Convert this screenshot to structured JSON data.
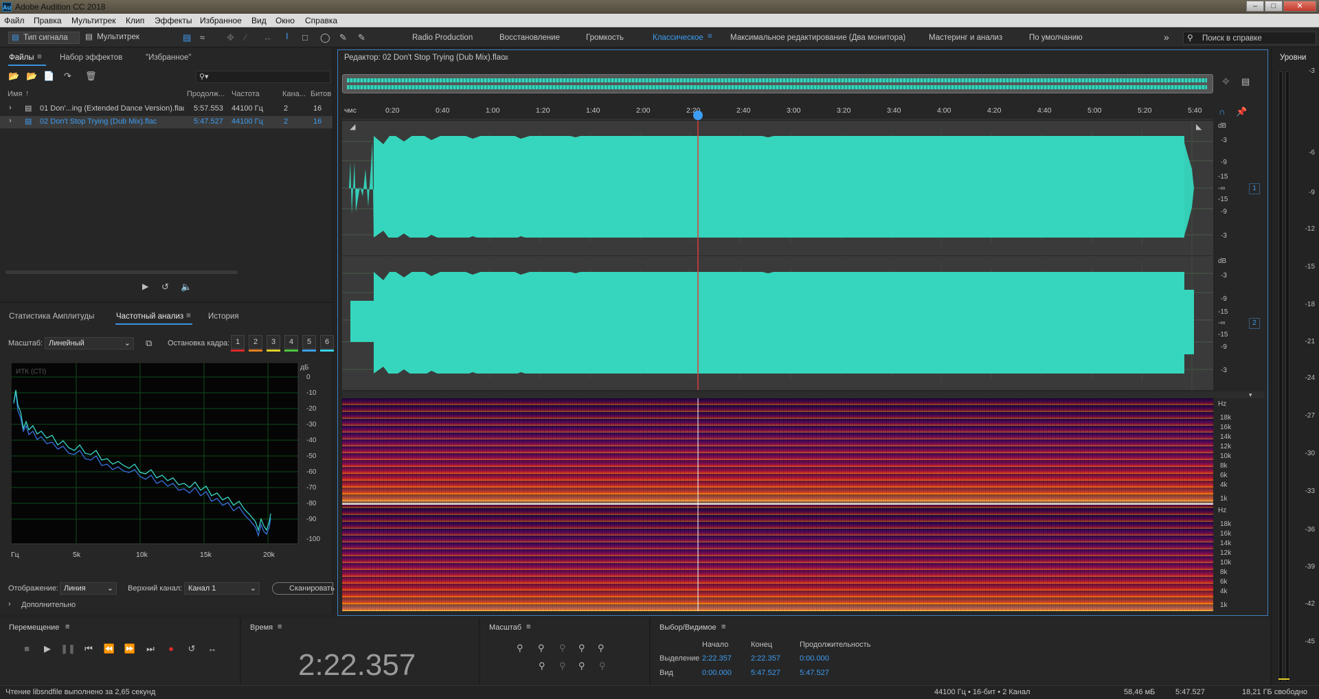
{
  "app": {
    "title": "Adobe Audition CC 2018",
    "logo": "Au"
  },
  "menu": [
    "Файл",
    "Правка",
    "Мультитрек",
    "Клип",
    "Эффекты",
    "Избранное",
    "Вид",
    "Окно",
    "Справка"
  ],
  "toolbar": {
    "waveform_label": "Тип сигнала",
    "multitrack_label": "Мультитрек",
    "workspaces": [
      "Radio Production",
      "Восстановление",
      "Громкость",
      "Классическое",
      "Максимальное редактирование (Два монитора)",
      "Мастеринг и анализ",
      "По умолчанию"
    ],
    "active_workspace": "Классическое",
    "search_placeholder": "Поиск в справке"
  },
  "files_panel": {
    "tabs": [
      "Файлы",
      "Набор эффектов",
      "\"Избранное\""
    ],
    "columns": [
      "Имя",
      "Продолж...",
      "Частота",
      "Кана...",
      "Битов"
    ],
    "rows": [
      {
        "name": "01 Don'...ing (Extended Dance Version).flac",
        "duration": "5:57.553",
        "rate": "44100 Гц",
        "channels": "2",
        "bits": "16",
        "selected": false
      },
      {
        "name": "02 Don't Stop Trying (Dub Mix).flac",
        "duration": "5:47.527",
        "rate": "44100 Гц",
        "channels": "2",
        "bits": "16",
        "selected": true
      }
    ]
  },
  "analysis_panel": {
    "tabs": [
      "Статистика Амплитуды",
      "Частотный анализ",
      "История"
    ],
    "scale_label": "Масштаб:",
    "scale_value": "Линейный",
    "freeze_label": "Остановка кадра:",
    "freeze_slots": [
      "1",
      "2",
      "3",
      "4",
      "5",
      "6"
    ],
    "freeze_colors": [
      "#e02a2a",
      "#e6801e",
      "#e2d12a",
      "#4ec83e",
      "#3fa0e6",
      "#3ad3e6"
    ],
    "plot_title": "ИТК (СТI)",
    "db_unit": "дБ",
    "db_ticks": [
      "0",
      "-10",
      "-20",
      "-30",
      "-40",
      "-50",
      "-60",
      "-70",
      "-80",
      "-90",
      "-100"
    ],
    "freq_ticks": [
      "Гц",
      "5k",
      "10k",
      "15k",
      "20k"
    ],
    "display_label": "Отображение:",
    "display_value": "Линия",
    "channel_label": "Верхний канал:",
    "channel_value": "Канал 1",
    "scan_label": "Сканировать",
    "advanced_label": "Дополнительно"
  },
  "editor": {
    "title": "Редактор: 02 Don't Stop Trying (Dub Mix).flac",
    "time_unit": "чмс",
    "time_ticks": [
      "0:20",
      "0:40",
      "1:00",
      "1:20",
      "1:40",
      "2:00",
      "2:20",
      "2:40",
      "3:00",
      "3:20",
      "3:40",
      "4:00",
      "4:20",
      "4:40",
      "5:00",
      "5:20",
      "5:40"
    ],
    "db_scale": [
      "dB",
      "-3",
      "-9",
      "-15",
      "-∞",
      "-15",
      "-9",
      "-3"
    ],
    "channels": [
      "1",
      "2"
    ],
    "hz_scale": [
      "Hz",
      "18k",
      "16k",
      "14k",
      "12k",
      "10k",
      "8k",
      "6k",
      "4k",
      "1k"
    ],
    "waveform_color": "#35d6bd",
    "playhead_color": "#e03a3a"
  },
  "levels_panel": {
    "title": "Уровни",
    "ticks": [
      "-3",
      "-6",
      "-9",
      "-12",
      "-15",
      "-18",
      "-21",
      "-24",
      "-27",
      "-30",
      "-33",
      "-36",
      "-39",
      "-42",
      "-45"
    ]
  },
  "transport": {
    "title": "Перемещение"
  },
  "time": {
    "title": "Время",
    "value": "2:22.357"
  },
  "zoom": {
    "title": "Масштаб"
  },
  "selection": {
    "title": "Выбор/Видимое",
    "headers": [
      "Начало",
      "Конец",
      "Продолжительность"
    ],
    "rows": [
      {
        "label": "Выделение",
        "start": "2:22.357",
        "end": "2:22.357",
        "duration": "0:00.000"
      },
      {
        "label": "Вид",
        "start": "0:00.000",
        "end": "5:47.527",
        "duration": "5:47.527"
      }
    ]
  },
  "status": {
    "left": "Чтение libsndfile выполнено за 2,65 секунд",
    "format": "44100 Гц • 16-бит • 2 Канал",
    "size": "58,46 мБ",
    "duration": "5:47.527",
    "free": "18,21 ГБ свободно"
  }
}
